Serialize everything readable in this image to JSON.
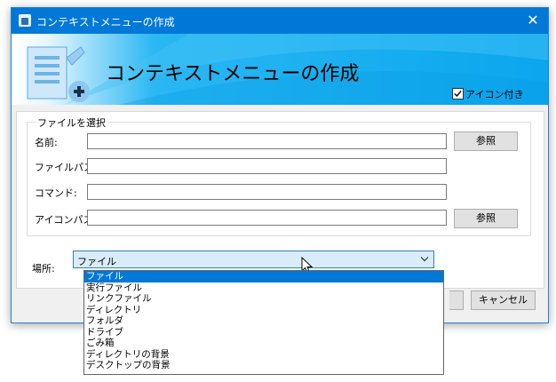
{
  "window": {
    "title": "コンテキストメニューの作成",
    "close_glyph": "✕"
  },
  "banner": {
    "title": "コンテキストメニューの作成",
    "icon_checkbox_label": "アイコン付き",
    "icon_checkbox_checked": true
  },
  "group": {
    "legend": "ファイルを選択",
    "name_label": "名前:",
    "file_path_label": "ファイルパス:",
    "command_label": "コマンド:",
    "icon_path_label": "アイコンパス:",
    "name_value": "",
    "file_path_value": "",
    "command_value": "",
    "icon_path_value": "",
    "browse_label": "参照",
    "browse_icon_label": "参照"
  },
  "location": {
    "label": "場所:",
    "selected": "ファイル",
    "options": [
      "ファイル",
      "実行ファイル",
      "リンクファイル",
      "ディレクトリ",
      "フォルダ",
      "ドライブ",
      "ごみ箱",
      "ディレクトリの背景",
      "デスクトップの背景"
    ]
  },
  "buttons": {
    "cancel": "キャンセル"
  },
  "colors": {
    "titlebar": "#0078d7",
    "selection": "#0078d7",
    "banner_blue": "#0aa6ee"
  },
  "icons": {
    "app": "app-icon",
    "banner": "document-add-icon",
    "close": "close-icon",
    "dropdown": "chevron-down-icon",
    "cursor": "mouse-cursor-icon"
  }
}
